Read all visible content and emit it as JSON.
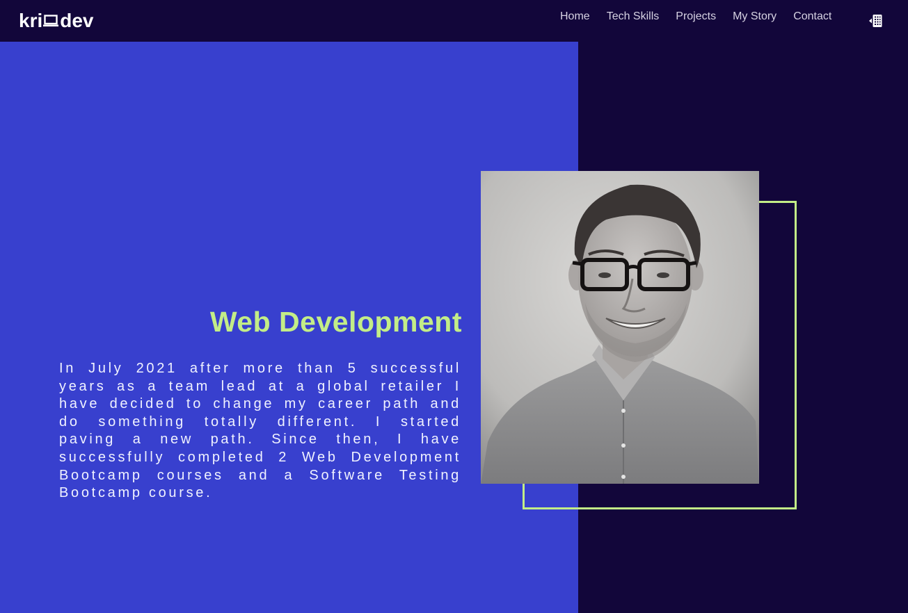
{
  "brand": {
    "name_left": "kri",
    "name_right": "dev",
    "accent_color": "#c3ed87",
    "background_color": "#12063a",
    "panel_color": "#3840ce"
  },
  "nav": {
    "items": [
      {
        "label": "Home"
      },
      {
        "label": "Tech Skills"
      },
      {
        "label": "Projects"
      },
      {
        "label": "My Story"
      },
      {
        "label": "Contact"
      }
    ],
    "toggle_icon": "sidebar-toggle-icon"
  },
  "hero": {
    "title": "Web Development",
    "text": "In July 2021 after more than 5 successful years as a team lead at a global retailer I have decided to change my career path and do something totally different. I started paving a new path. Since then, I have successfully completed 2 Web Development Bootcamp courses and a Software Testing Bootcamp course."
  },
  "profile": {
    "photo_icon": "profile-photo"
  }
}
